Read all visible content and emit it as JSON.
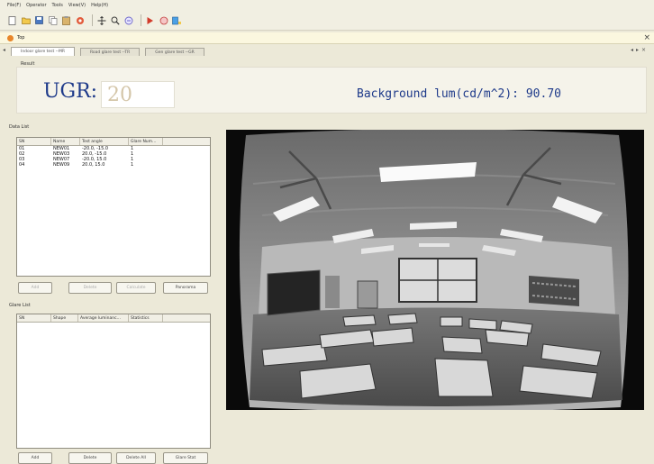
{
  "menubar": {
    "items": [
      "File(F)",
      "Operator",
      "Tools",
      "View(V)",
      "Help(H)"
    ]
  },
  "toolbar": {
    "icons": [
      "new-icon",
      "open-icon",
      "save-icon",
      "copy-icon",
      "paste-icon",
      "target-icon",
      "pan-icon",
      "zoom-in-icon",
      "zoom-out-icon",
      "play-icon",
      "stop-icon",
      "calc-icon"
    ]
  },
  "document": {
    "title": "Top"
  },
  "tabs": [
    {
      "label": "Indoor glare test --MR",
      "active": true
    },
    {
      "label": "Road glare test --TR",
      "active": false
    },
    {
      "label": "Gen glare test --GR",
      "active": false
    }
  ],
  "result": {
    "group_label": "Result",
    "ugr_label": "UGR:",
    "ugr_value": "20",
    "background_label": "Background lum(cd/m^2): 90.70"
  },
  "data_list": {
    "title": "Data List",
    "columns": [
      "SN",
      "Name",
      "Test angle",
      "Glare Num..."
    ],
    "rows": [
      [
        "01",
        "NEW01",
        "-20.0, -15.0",
        "1"
      ],
      [
        "02",
        "NEW03",
        "20.0, -15.0",
        "1"
      ],
      [
        "03",
        "NEW07",
        "-20.0, 15.0",
        "1"
      ],
      [
        "04",
        "NEW09",
        "20.0, 15.0",
        "1"
      ]
    ],
    "buttons": {
      "add": "Add",
      "delete": "Delete",
      "calculate": "Calculate",
      "panorama": "Panorama"
    }
  },
  "glare_list": {
    "title": "Glare List",
    "columns": [
      "SN",
      "Shape",
      "Average luminanc...",
      "Statistics"
    ],
    "buttons": {
      "add": "Add",
      "delete": "Delete",
      "delete_all": "Delete All",
      "glare_stat": "Glare Stat"
    }
  }
}
